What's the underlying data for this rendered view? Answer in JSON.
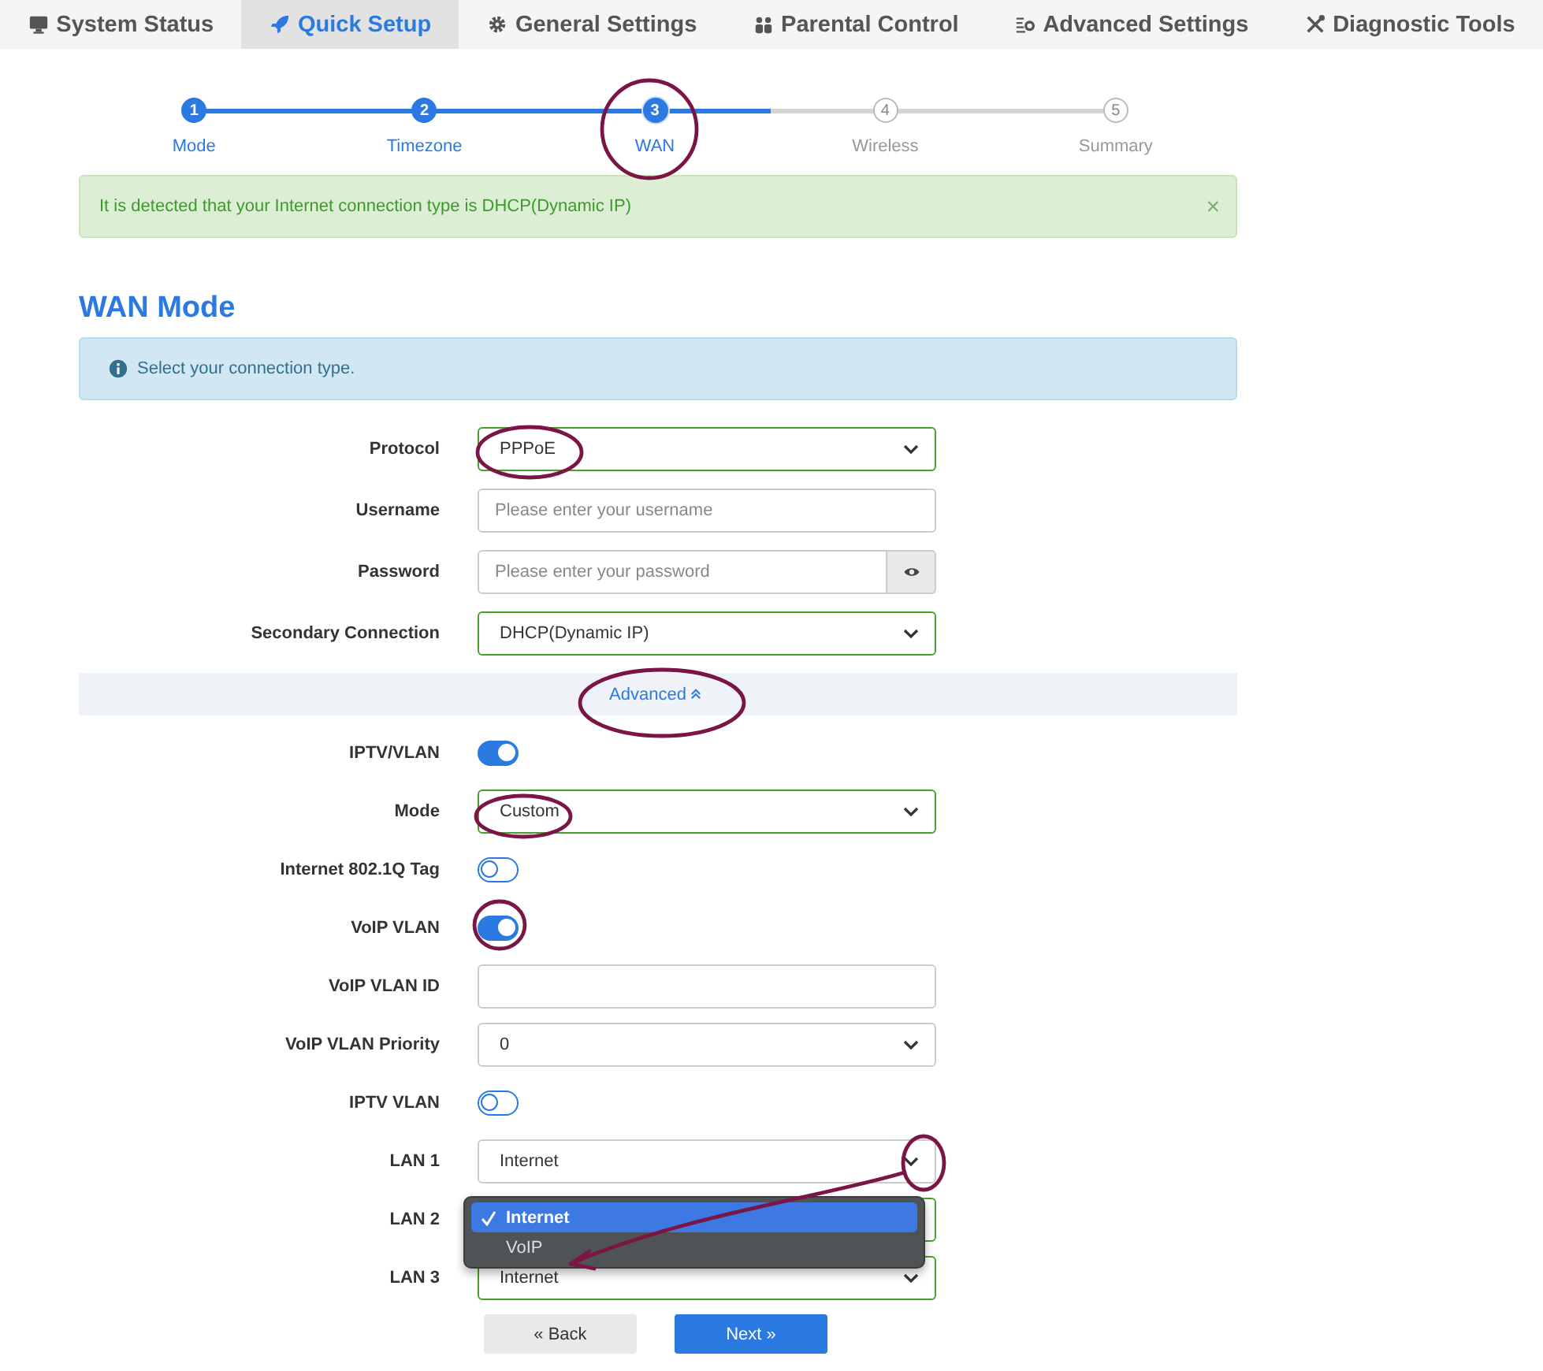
{
  "tabs": [
    {
      "label": "System Status",
      "selected": false
    },
    {
      "label": "Quick Setup",
      "selected": true
    },
    {
      "label": "General Settings",
      "selected": false
    },
    {
      "label": "Parental Control",
      "selected": false
    },
    {
      "label": "Advanced Settings",
      "selected": false
    },
    {
      "label": "Diagnostic Tools",
      "selected": false
    }
  ],
  "steps": [
    {
      "number": "1",
      "label": "Mode",
      "completed": true,
      "selected": false
    },
    {
      "number": "2",
      "label": "Timezone",
      "completed": true,
      "selected": false
    },
    {
      "number": "3",
      "label": "WAN",
      "completed": true,
      "selected": true
    },
    {
      "number": "4",
      "label": "Wireless",
      "completed": false,
      "selected": false
    },
    {
      "number": "5",
      "label": "Summary",
      "completed": false,
      "selected": false
    }
  ],
  "alert": {
    "text": "It is detected that your Internet connection type is DHCP(Dynamic IP)",
    "close": "×"
  },
  "section_title": "WAN Mode",
  "info": {
    "text": "Select your connection type."
  },
  "fields": [
    {
      "label": "Protocol",
      "kind": "select",
      "value": "PPPoE",
      "validated": true
    },
    {
      "label": "Username",
      "kind": "text",
      "placeholder": "Please enter your username",
      "validated": false
    },
    {
      "label": "Password",
      "kind": "password",
      "placeholder": "Please enter your password",
      "validated": false
    },
    {
      "label": "Secondary Connection",
      "kind": "select",
      "value": "DHCP(Dynamic IP)",
      "validated": true
    }
  ],
  "advanced": {
    "label": "Advanced",
    "expanded": true
  },
  "advanced_fields": [
    {
      "label": "IPTV/VLAN",
      "kind": "toggle",
      "on": true
    },
    {
      "label": "Mode",
      "kind": "select",
      "value": "Custom",
      "validated": true
    },
    {
      "label": "Internet 802.1Q Tag",
      "kind": "toggle",
      "on": false
    },
    {
      "label": "VoIP VLAN",
      "kind": "toggle",
      "on": true
    },
    {
      "label": "VoIP VLAN ID",
      "kind": "text",
      "validated": false
    },
    {
      "label": "VoIP VLAN Priority",
      "kind": "select",
      "value": "0",
      "validated": false
    },
    {
      "label": "IPTV VLAN",
      "kind": "toggle",
      "on": false
    },
    {
      "label": "LAN 1",
      "kind": "select",
      "value": "Internet",
      "validated": false
    },
    {
      "label": "LAN 2",
      "kind": "select",
      "validated": true,
      "dropdown": [
        {
          "label": "Internet",
          "selected": true
        },
        {
          "label": "VoIP",
          "selected": false
        }
      ]
    },
    {
      "label": "LAN 3",
      "kind": "select",
      "value": "Internet",
      "validated": true
    }
  ],
  "buttons": [
    {
      "label": "« Back",
      "kind": "secondary"
    },
    {
      "label": "Next »",
      "kind": "primary"
    }
  ]
}
